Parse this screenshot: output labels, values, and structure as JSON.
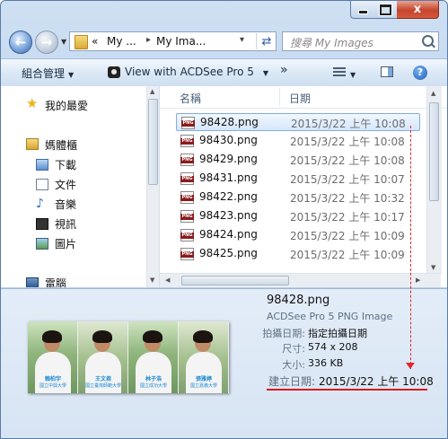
{
  "nav": {
    "back_glyph": "←",
    "forward_glyph": "→",
    "breadcrumb": [
      "«",
      "My ...",
      "My Ima..."
    ],
    "search_placeholder": "搜尋 My Images"
  },
  "caption": {
    "minimize": "",
    "maximize": "",
    "close": "x"
  },
  "command_bar": {
    "organize": "組合管理",
    "view_with": "View with ACDSee Pro 5",
    "more": "»",
    "help": "?"
  },
  "sidebar": {
    "favorites": "我的最愛",
    "libraries": "媽體櫃",
    "items": [
      {
        "label": "下載",
        "icon": "download-icon"
      },
      {
        "label": "文件",
        "icon": "document-icon"
      },
      {
        "label": "音樂",
        "icon": "music-icon"
      },
      {
        "label": "視訊",
        "icon": "video-icon"
      },
      {
        "label": "圖片",
        "icon": "picture-icon"
      }
    ],
    "computer": "電腦"
  },
  "file_list": {
    "columns": {
      "name": "名稱",
      "date": "日期"
    },
    "files": [
      {
        "name": "98428.png",
        "date": "2015/3/22 上午 10:08",
        "selected": true
      },
      {
        "name": "98430.png",
        "date": "2015/3/22 上午 10:08"
      },
      {
        "name": "98429.png",
        "date": "2015/3/22 上午 10:08"
      },
      {
        "name": "98431.png",
        "date": "2015/3/22 上午 10:07"
      },
      {
        "name": "98422.png",
        "date": "2015/3/22 上午 10:32"
      },
      {
        "name": "98423.png",
        "date": "2015/3/22 上午 10:17"
      },
      {
        "name": "98424.png",
        "date": "2015/3/22 上午 10:09"
      },
      {
        "name": "98425.png",
        "date": "2015/3/22 上午 10:09"
      }
    ]
  },
  "details": {
    "filename": "98428.png",
    "filetype": "ACDSee Pro 5 PNG Image",
    "fields": [
      {
        "label": "拍攝日期:",
        "value": "指定拍攝日期"
      },
      {
        "label": "尺寸:",
        "value": "574 x 208"
      },
      {
        "label": "大小:",
        "value": "336 KB"
      },
      {
        "label": "建立日期:",
        "value": "2015/3/22 上午 10:08"
      }
    ],
    "photos": [
      {
        "name": "賴柏宇",
        "school": "國立中興大學"
      },
      {
        "name": "王文君",
        "school": "國立臺灣師範大學"
      },
      {
        "name": "林子浩",
        "school": "國立成功大學"
      },
      {
        "name": "張雅婷",
        "school": "國立嘉義大學"
      }
    ]
  },
  "colors": {
    "annotation": "#d61c1c",
    "selection": "#cce1fa"
  }
}
